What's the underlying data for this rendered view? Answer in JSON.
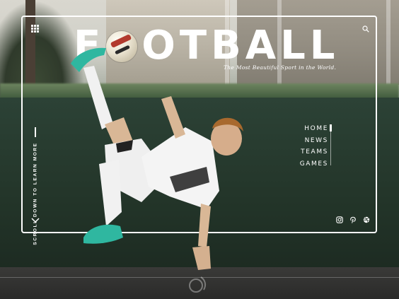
{
  "hero": {
    "title_before_ball": "F",
    "title_after_ball": "OTBALL",
    "tagline": "The Most Beautiful Sport in the World."
  },
  "header": {
    "menu_icon": "grid-menu-icon",
    "search_icon": "search-icon"
  },
  "scroll_hint": {
    "label": "SCROLL DOWN TO LEARN MORE",
    "arrow_icon": "chevron-down-icon"
  },
  "nav": {
    "items": [
      {
        "label": "HOME",
        "active": true
      },
      {
        "label": "NEWS",
        "active": false
      },
      {
        "label": "TEAMS",
        "active": false
      },
      {
        "label": "GAMES",
        "active": false
      }
    ]
  },
  "social": {
    "icons": [
      "instagram-icon",
      "pinterest-icon",
      "dribbble-icon"
    ]
  },
  "colors": {
    "frame": "#ffffff",
    "background": "#233529",
    "text": "#ffffff",
    "kit": "#f2f2f2",
    "boots": "#2fb7a0"
  }
}
